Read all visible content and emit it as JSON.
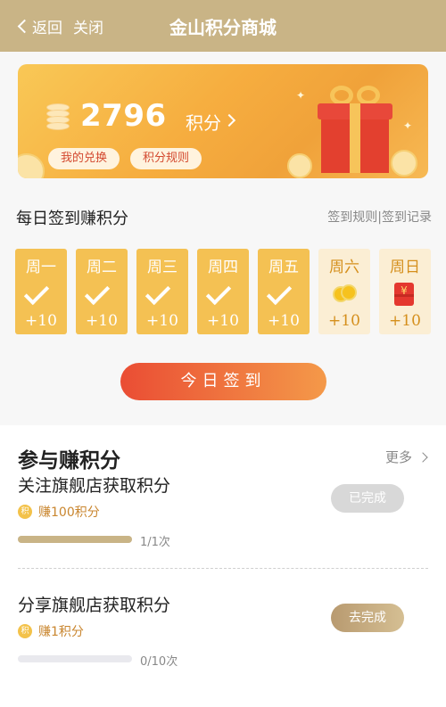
{
  "header": {
    "back_label": "返回",
    "close_label": "关闭",
    "title": "金山积分商城"
  },
  "banner": {
    "points": "2796",
    "points_unit": "积分",
    "my_exchange_label": "我的兑换",
    "rules_label": "积分规则"
  },
  "checkin": {
    "title": "每日签到赚积分",
    "rules_link": "签到规则",
    "separator": "|",
    "records_link": "签到记录",
    "days": [
      {
        "name": "周一",
        "points": "+10",
        "status": "done",
        "icon": "check-icon"
      },
      {
        "name": "周二",
        "points": "+10",
        "status": "done",
        "icon": "check-icon"
      },
      {
        "name": "周三",
        "points": "+10",
        "status": "done",
        "icon": "check-icon"
      },
      {
        "name": "周四",
        "points": "+10",
        "status": "done",
        "icon": "check-icon"
      },
      {
        "name": "周五",
        "points": "+10",
        "status": "done",
        "icon": "check-icon"
      },
      {
        "name": "周六",
        "points": "+10",
        "status": "pending",
        "icon": "coins-icon"
      },
      {
        "name": "周日",
        "points": "+10",
        "status": "pending",
        "icon": "red-envelope-icon"
      }
    ],
    "button_label": "今日签到"
  },
  "tasks": {
    "title": "参与赚积分",
    "more_label": "更多",
    "reward_icon_text": "积",
    "items": [
      {
        "name": "关注旗舰店获取积分",
        "reward": "赚100积分",
        "progress_text": "1/1次",
        "progress": 1.0,
        "button_label": "已完成",
        "state": "completed"
      },
      {
        "name": "分享旗舰店获取积分",
        "reward": "赚1积分",
        "progress_text": "0/10次",
        "progress": 0.0,
        "button_label": "去完成",
        "state": "pending"
      }
    ]
  },
  "colors": {
    "header_bg": "#c9b486",
    "accent_orange": "#ea4d34",
    "day_done": "#f4c153",
    "day_pending": "#fbeed4"
  }
}
